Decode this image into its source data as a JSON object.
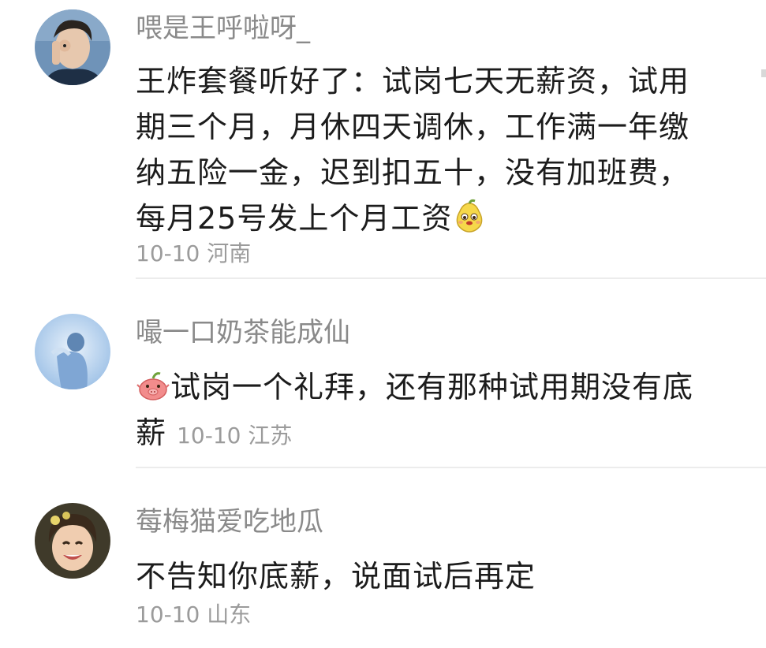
{
  "comments": [
    {
      "username": "喂是王呼啦呀_",
      "text": "王炸套餐听好了：试岗七天无薪资，试用期三个月，月休四天调休，工作满一年缴纳五险一金，迟到扣五十，没有加班费，每月25号发上个月工资",
      "emoji": "yellow-pear-emoji",
      "date": "10-10",
      "location": "河南"
    },
    {
      "username": "嘬一口奶茶能成仙",
      "emoji": "pink-pig-emoji",
      "text": "试岗一个礼拜，还有那种试用期没有底薪",
      "date": "10-10",
      "location": "江苏"
    },
    {
      "username": "莓梅猫爱吃地瓜",
      "text": "不告知你底薪，说面试后再定",
      "date": "10-10",
      "location": "山东"
    }
  ]
}
